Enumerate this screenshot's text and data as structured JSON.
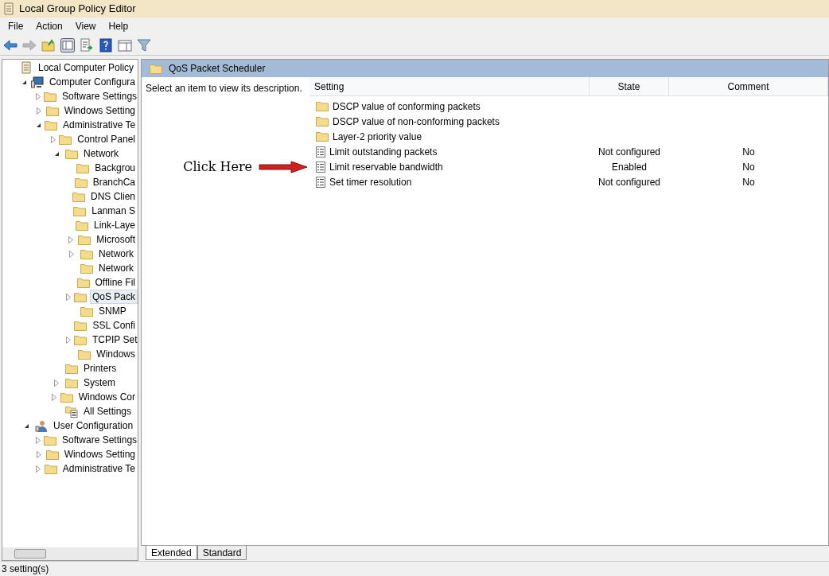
{
  "window": {
    "title": "Local Group Policy Editor"
  },
  "menu": [
    "File",
    "Action",
    "View",
    "Help"
  ],
  "toolbar": [
    {
      "kind": "back",
      "disabled": false
    },
    {
      "kind": "forward",
      "disabled": true
    },
    {
      "kind": "up",
      "disabled": false
    },
    {
      "kind": "pane",
      "disabled": false
    },
    {
      "kind": "export",
      "disabled": false
    },
    {
      "kind": "help",
      "disabled": false
    },
    {
      "kind": "panel",
      "disabled": false
    },
    {
      "kind": "filter",
      "disabled": false
    }
  ],
  "tree": [
    {
      "label": "Local Computer Policy",
      "kind": "policy",
      "selected": false,
      "children": [
        {
          "label": "Computer Configura",
          "kind": "computer",
          "selected": false,
          "expanded": true,
          "children": [
            {
              "label": "Software Settings",
              "kind": "folder",
              "selected": false,
              "expanded": false
            },
            {
              "label": "Windows Setting",
              "kind": "folder",
              "selected": false,
              "expanded": false
            },
            {
              "label": "Administrative Te",
              "kind": "folder",
              "selected": false,
              "expanded": true,
              "children": [
                {
                  "label": "Control Panel",
                  "kind": "folder",
                  "selected": false,
                  "expanded": false
                },
                {
                  "label": "Network",
                  "kind": "folder",
                  "selected": false,
                  "expanded": true,
                  "children": [
                    {
                      "label": "Backgrou",
                      "kind": "folder",
                      "selected": false
                    },
                    {
                      "label": "BranchCa",
                      "kind": "folder",
                      "selected": false
                    },
                    {
                      "label": "DNS Clien",
                      "kind": "folder",
                      "selected": false
                    },
                    {
                      "label": "Lanman S",
                      "kind": "folder",
                      "selected": false
                    },
                    {
                      "label": "Link-Laye",
                      "kind": "folder",
                      "selected": false
                    },
                    {
                      "label": "Microsoft",
                      "kind": "folder",
                      "selected": false,
                      "expanded": false
                    },
                    {
                      "label": "Network",
                      "kind": "folder",
                      "selected": false,
                      "expanded": false
                    },
                    {
                      "label": "Network",
                      "kind": "folder",
                      "selected": false
                    },
                    {
                      "label": "Offline Fil",
                      "kind": "folder",
                      "selected": false
                    },
                    {
                      "label": "QoS Pack",
                      "kind": "folder",
                      "selected": true,
                      "expanded": false
                    },
                    {
                      "label": "SNMP",
                      "kind": "folder",
                      "selected": false
                    },
                    {
                      "label": "SSL Confi",
                      "kind": "folder",
                      "selected": false
                    },
                    {
                      "label": "TCPIP Set",
                      "kind": "folder",
                      "selected": false,
                      "expanded": false
                    },
                    {
                      "label": "Windows",
                      "kind": "folder",
                      "selected": false
                    }
                  ]
                },
                {
                  "label": "Printers",
                  "kind": "folder",
                  "selected": false
                },
                {
                  "label": "System",
                  "kind": "folder",
                  "selected": false,
                  "expanded": false
                },
                {
                  "label": "Windows Cor",
                  "kind": "folder",
                  "selected": false,
                  "expanded": false
                },
                {
                  "label": "All Settings",
                  "kind": "settings",
                  "selected": false
                }
              ]
            }
          ]
        },
        {
          "label": "User Configuration",
          "kind": "user",
          "selected": false,
          "expanded": true,
          "children": [
            {
              "label": "Software Settings",
              "kind": "folder",
              "selected": false,
              "expanded": false
            },
            {
              "label": "Windows Setting",
              "kind": "folder",
              "selected": false,
              "expanded": false
            },
            {
              "label": "Administrative Te",
              "kind": "folder",
              "selected": false,
              "expanded": false
            }
          ]
        }
      ]
    }
  ],
  "content": {
    "title": "QoS Packet Scheduler",
    "description": "Select an item to view its description.",
    "columns": [
      "Setting",
      "State",
      "Comment"
    ],
    "rows": [
      {
        "kind": "folder",
        "setting": "DSCP value of conforming packets"
      },
      {
        "kind": "folder",
        "setting": "DSCP value of non-conforming packets"
      },
      {
        "kind": "folder",
        "setting": "Layer-2 priority value"
      },
      {
        "kind": "policy",
        "setting": "Limit outstanding packets",
        "state": "Not configured",
        "comment": "No"
      },
      {
        "kind": "policy",
        "setting": "Limit reservable bandwidth",
        "state": "Enabled",
        "comment": "No",
        "annotation": "Click Here"
      },
      {
        "kind": "policy",
        "setting": "Set timer resolution",
        "state": "Not configured",
        "comment": "No"
      }
    ]
  },
  "tabs": [
    {
      "label": "Extended",
      "selected": true
    },
    {
      "label": "Standard",
      "selected": false
    }
  ],
  "status_bar": "3 setting(s)"
}
